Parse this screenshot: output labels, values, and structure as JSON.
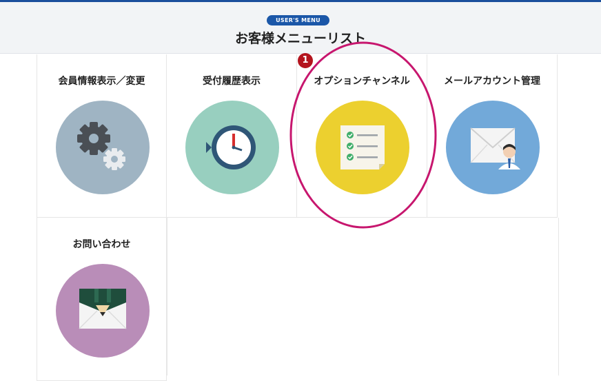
{
  "header": {
    "badge": "USER'S MENU",
    "title": "お客様メニューリスト"
  },
  "menu": {
    "items": [
      {
        "label": "会員情報表示／変更",
        "icon": "gears-icon",
        "color": "#9fb4c3"
      },
      {
        "label": "受付履歴表示",
        "icon": "history-clock-icon",
        "color": "#98cfbf"
      },
      {
        "label": "オプションチャンネル",
        "icon": "checklist-icon",
        "color": "#ecd02f"
      },
      {
        "label": "メールアカウント管理",
        "icon": "mail-account-icon",
        "color": "#72a9d9"
      },
      {
        "label": "お問い合わせ",
        "icon": "pencil-envelope-icon",
        "color": "#b98db8"
      }
    ]
  },
  "annotation": {
    "marker_number": "1",
    "marker_color": "#b4141e",
    "highlight_color": "#c7166e"
  },
  "colors": {
    "accent": "#1b57a8",
    "header_bg": "#f2f4f6"
  }
}
